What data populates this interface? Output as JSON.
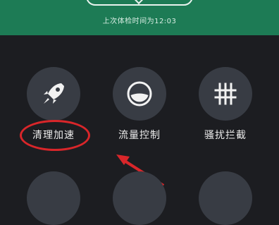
{
  "header": {
    "last_check_text": "上次体检时间为12:03"
  },
  "tiles": [
    {
      "label": "清理加速",
      "icon": "rocket-icon"
    },
    {
      "label": "流量控制",
      "icon": "traffic-gauge-icon"
    },
    {
      "label": "骚扰拦截",
      "icon": "firewall-grid-icon"
    }
  ],
  "annotation": {
    "color": "#d9262a"
  },
  "colors": {
    "header_bg": "#1d7b55",
    "body_bg": "#1c1d21",
    "tile_circle": "#383c44"
  }
}
